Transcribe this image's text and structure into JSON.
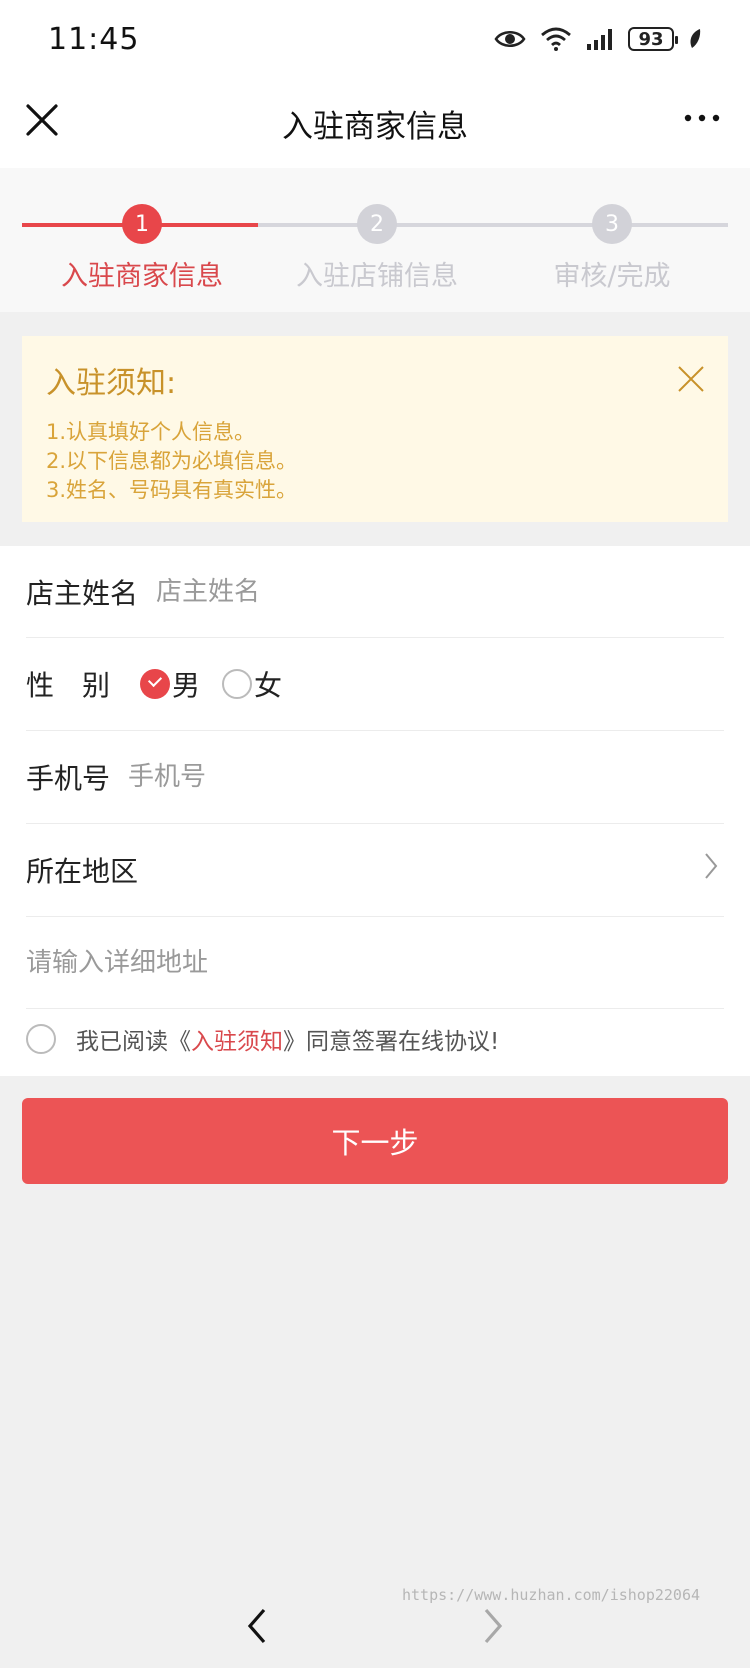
{
  "status_bar": {
    "time": "11:45",
    "battery": "93",
    "icons": [
      "eye-icon",
      "wifi-icon",
      "signal-icon",
      "battery-icon",
      "leaf-icon"
    ]
  },
  "nav": {
    "title": "入驻商家信息",
    "close_icon": "close-icon",
    "more_icon": "more-icon"
  },
  "steps": [
    {
      "number": "1",
      "label": "入驻商家信息",
      "active": true
    },
    {
      "number": "2",
      "label": "入驻店铺信息",
      "active": false
    },
    {
      "number": "3",
      "label": "审核/完成",
      "active": false
    }
  ],
  "notice": {
    "title": "入驻须知:",
    "lines": [
      "1.认真填好个人信息。",
      "2.以下信息都为必填信息。",
      "3.姓名、号码具有真实性。"
    ]
  },
  "form": {
    "owner_name": {
      "label": "店主姓名",
      "placeholder": "店主姓名",
      "value": ""
    },
    "gender": {
      "label": "性　别",
      "options": [
        "男",
        "女"
      ],
      "selected": "男"
    },
    "phone": {
      "label": "手机号",
      "placeholder": "手机号",
      "value": ""
    },
    "region": {
      "label": "所在地区",
      "value": ""
    },
    "address": {
      "placeholder": "请输入详细地址",
      "value": ""
    },
    "agree": {
      "prefix": "我已阅读《",
      "link": "入驻须知",
      "suffix": "》同意签署在线协议!",
      "checked": false
    }
  },
  "next_button": {
    "label": "下一步"
  },
  "watermark": "https://www.huzhan.com/ishop22064",
  "colors": {
    "accent": "#e8464a",
    "notice_bg": "#fff9e6",
    "notice_title": "#c8922a"
  }
}
